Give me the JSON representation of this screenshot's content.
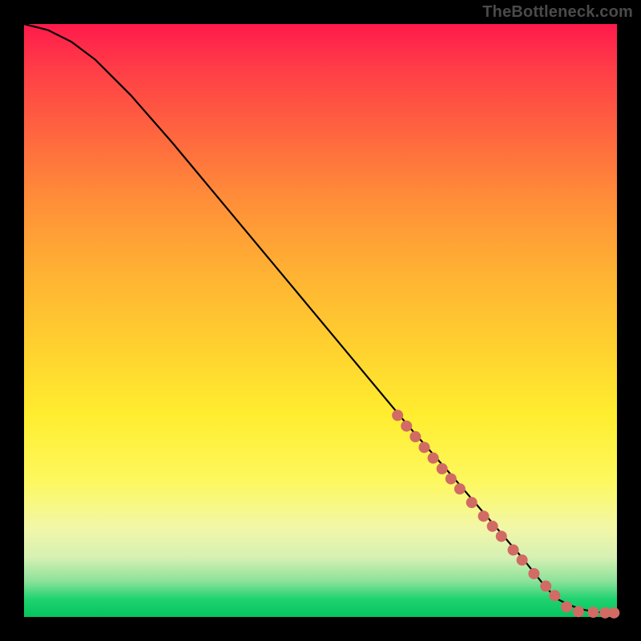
{
  "watermark": "TheBottleneck.com",
  "chart_data": {
    "type": "line",
    "title": "",
    "xlabel": "",
    "ylabel": "",
    "xlim": [
      0,
      100
    ],
    "ylim": [
      0,
      100
    ],
    "grid": false,
    "legend": false,
    "line": {
      "x": [
        0,
        4,
        8,
        12,
        18,
        25,
        35,
        45,
        55,
        65,
        72,
        78,
        84,
        88,
        90,
        92,
        94,
        96,
        98,
        100
      ],
      "y": [
        100,
        99,
        97,
        94,
        88,
        80,
        68,
        56,
        44,
        32,
        24,
        17,
        10,
        5,
        3,
        2,
        1.3,
        0.9,
        0.7,
        0.7
      ]
    },
    "markers": {
      "color": "#d16b63",
      "radius_px": 7,
      "points": [
        {
          "x": 63,
          "y": 34
        },
        {
          "x": 64.5,
          "y": 32.2
        },
        {
          "x": 66,
          "y": 30.4
        },
        {
          "x": 67.5,
          "y": 28.6
        },
        {
          "x": 69,
          "y": 26.8
        },
        {
          "x": 70.5,
          "y": 25
        },
        {
          "x": 72,
          "y": 23.3
        },
        {
          "x": 73.5,
          "y": 21.6
        },
        {
          "x": 75.5,
          "y": 19.3
        },
        {
          "x": 77.5,
          "y": 17
        },
        {
          "x": 79,
          "y": 15.3
        },
        {
          "x": 80.5,
          "y": 13.6
        },
        {
          "x": 82.5,
          "y": 11.3
        },
        {
          "x": 84,
          "y": 9.6
        },
        {
          "x": 86,
          "y": 7.3
        },
        {
          "x": 88,
          "y": 5.2
        },
        {
          "x": 89.5,
          "y": 3.6
        },
        {
          "x": 91.5,
          "y": 1.7
        },
        {
          "x": 93.5,
          "y": 0.9
        },
        {
          "x": 96,
          "y": 0.8
        },
        {
          "x": 98,
          "y": 0.7
        },
        {
          "x": 99.5,
          "y": 0.7
        }
      ]
    }
  }
}
